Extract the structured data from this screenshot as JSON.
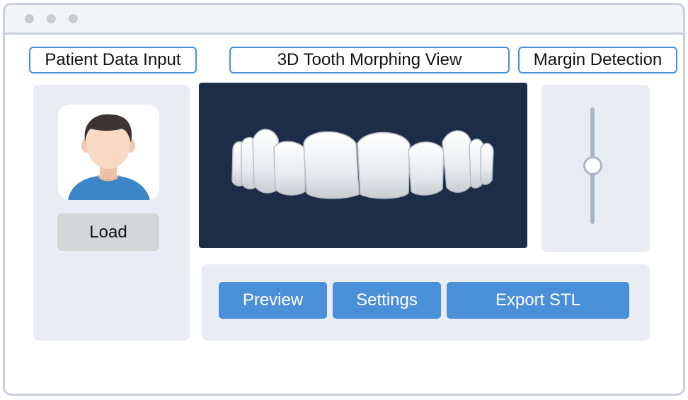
{
  "window": {
    "controls": [
      "window-dot",
      "window-dot",
      "window-dot"
    ]
  },
  "sections": {
    "patient_label": "Patient Data Input",
    "viewer_label": "3D Tooth Morphing View",
    "margin_label": "Margin Detection"
  },
  "patient": {
    "avatar_icon": "user-avatar-icon",
    "load_label": "Load"
  },
  "viewer": {
    "background_color": "#1e2d47",
    "model_icon": "teeth-model-icon"
  },
  "margin": {
    "slider_value": 0.5
  },
  "actions": {
    "preview_label": "Preview",
    "settings_label": "Settings",
    "export_label": "Export STL"
  },
  "colors": {
    "accent": "#4a90d9",
    "panel": "#e9edf3",
    "load_button": "#d5d6d8"
  }
}
